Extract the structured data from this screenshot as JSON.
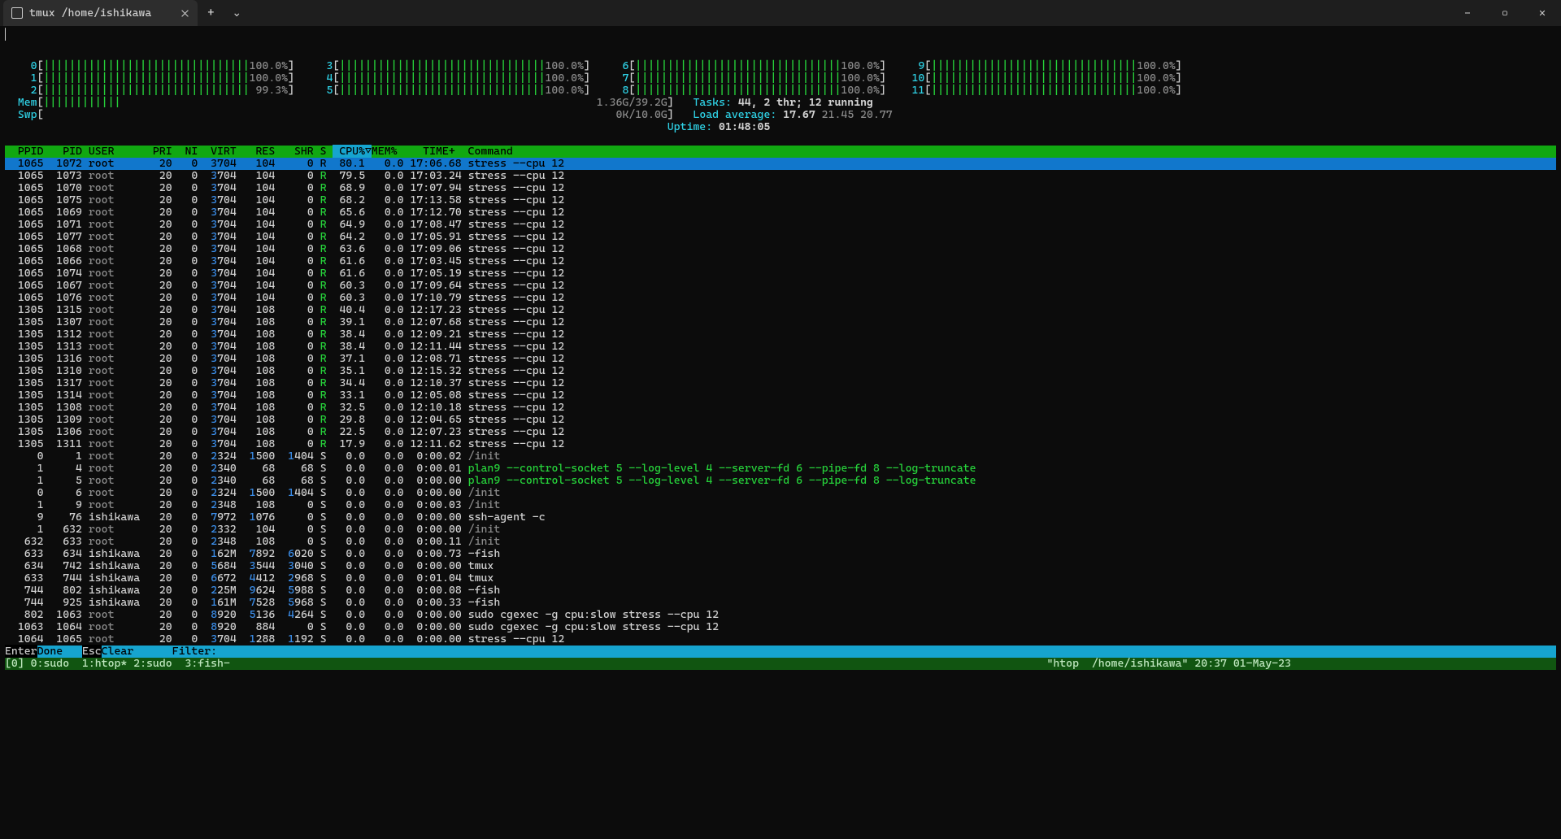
{
  "window": {
    "tab_title": "tmux /home/ishikawa",
    "plus": "+",
    "chev": "⌄",
    "min": "—",
    "max": "▢",
    "close": "✕"
  },
  "cpu_meters": [
    {
      "n": "0",
      "pct": "100.0%"
    },
    {
      "n": "1",
      "pct": "100.0%"
    },
    {
      "n": "2",
      "pct": "99.3%"
    },
    {
      "n": "3",
      "pct": "100.0%"
    },
    {
      "n": "4",
      "pct": "100.0%"
    },
    {
      "n": "5",
      "pct": "100.0%"
    },
    {
      "n": "6",
      "pct": "100.0%"
    },
    {
      "n": "7",
      "pct": "100.0%"
    },
    {
      "n": "8",
      "pct": "100.0%"
    },
    {
      "n": "9",
      "pct": "100.0%"
    },
    {
      "n": "10",
      "pct": "100.0%"
    },
    {
      "n": "11",
      "pct": "100.0%"
    }
  ],
  "mem": {
    "label": "Mem",
    "used": "1.36G",
    "total": "39.2G"
  },
  "swp": {
    "label": "Swp",
    "used": "0K",
    "total": "10.0G"
  },
  "summary": {
    "tasks_label": "Tasks: ",
    "tasks_val": "44, 2 thr; 12 running",
    "load_label": "Load average: ",
    "load_vals": "17.67 21.45 20.77",
    "uptime_label": "Uptime: ",
    "uptime_val": "01:48:05"
  },
  "cols": {
    "ppid": "PPID",
    "pid": "PID",
    "user": "USER",
    "pri": "PRI",
    "ni": "NI",
    "virt": "VIRT",
    "res": "RES",
    "shr": "SHR",
    "s": "S",
    "cpu": "CPU%",
    "sort": "▽",
    "mem": "MEM%",
    "time": "TIME+",
    "cmd": "Command"
  },
  "procs": [
    {
      "ppid": "1065",
      "pid": "1072",
      "user": "root",
      "pri": "20",
      "ni": "0",
      "virt": "3704",
      "res": "104",
      "shr": "0",
      "s": "R",
      "cpu": "80.1",
      "mem": "0.0",
      "time": "17:06.68",
      "cmd": "stress --cpu 12",
      "sel": true
    },
    {
      "ppid": "1065",
      "pid": "1073",
      "user": "root",
      "pri": "20",
      "ni": "0",
      "virt": "3704",
      "res": "104",
      "shr": "0",
      "s": "R",
      "cpu": "79.5",
      "mem": "0.0",
      "time": "17:03.24",
      "cmd": "stress --cpu 12"
    },
    {
      "ppid": "1065",
      "pid": "1070",
      "user": "root",
      "pri": "20",
      "ni": "0",
      "virt": "3704",
      "res": "104",
      "shr": "0",
      "s": "R",
      "cpu": "68.9",
      "mem": "0.0",
      "time": "17:07.94",
      "cmd": "stress --cpu 12"
    },
    {
      "ppid": "1065",
      "pid": "1075",
      "user": "root",
      "pri": "20",
      "ni": "0",
      "virt": "3704",
      "res": "104",
      "shr": "0",
      "s": "R",
      "cpu": "68.2",
      "mem": "0.0",
      "time": "17:13.58",
      "cmd": "stress --cpu 12"
    },
    {
      "ppid": "1065",
      "pid": "1069",
      "user": "root",
      "pri": "20",
      "ni": "0",
      "virt": "3704",
      "res": "104",
      "shr": "0",
      "s": "R",
      "cpu": "65.6",
      "mem": "0.0",
      "time": "17:12.70",
      "cmd": "stress --cpu 12"
    },
    {
      "ppid": "1065",
      "pid": "1071",
      "user": "root",
      "pri": "20",
      "ni": "0",
      "virt": "3704",
      "res": "104",
      "shr": "0",
      "s": "R",
      "cpu": "64.9",
      "mem": "0.0",
      "time": "17:08.47",
      "cmd": "stress --cpu 12"
    },
    {
      "ppid": "1065",
      "pid": "1077",
      "user": "root",
      "pri": "20",
      "ni": "0",
      "virt": "3704",
      "res": "104",
      "shr": "0",
      "s": "R",
      "cpu": "64.2",
      "mem": "0.0",
      "time": "17:05.91",
      "cmd": "stress --cpu 12"
    },
    {
      "ppid": "1065",
      "pid": "1068",
      "user": "root",
      "pri": "20",
      "ni": "0",
      "virt": "3704",
      "res": "104",
      "shr": "0",
      "s": "R",
      "cpu": "63.6",
      "mem": "0.0",
      "time": "17:09.06",
      "cmd": "stress --cpu 12"
    },
    {
      "ppid": "1065",
      "pid": "1066",
      "user": "root",
      "pri": "20",
      "ni": "0",
      "virt": "3704",
      "res": "104",
      "shr": "0",
      "s": "R",
      "cpu": "61.6",
      "mem": "0.0",
      "time": "17:03.45",
      "cmd": "stress --cpu 12"
    },
    {
      "ppid": "1065",
      "pid": "1074",
      "user": "root",
      "pri": "20",
      "ni": "0",
      "virt": "3704",
      "res": "104",
      "shr": "0",
      "s": "R",
      "cpu": "61.6",
      "mem": "0.0",
      "time": "17:05.19",
      "cmd": "stress --cpu 12"
    },
    {
      "ppid": "1065",
      "pid": "1067",
      "user": "root",
      "pri": "20",
      "ni": "0",
      "virt": "3704",
      "res": "104",
      "shr": "0",
      "s": "R",
      "cpu": "60.3",
      "mem": "0.0",
      "time": "17:09.64",
      "cmd": "stress --cpu 12"
    },
    {
      "ppid": "1065",
      "pid": "1076",
      "user": "root",
      "pri": "20",
      "ni": "0",
      "virt": "3704",
      "res": "104",
      "shr": "0",
      "s": "R",
      "cpu": "60.3",
      "mem": "0.0",
      "time": "17:10.79",
      "cmd": "stress --cpu 12"
    },
    {
      "ppid": "1305",
      "pid": "1315",
      "user": "root",
      "pri": "20",
      "ni": "0",
      "virt": "3704",
      "res": "108",
      "shr": "0",
      "s": "R",
      "cpu": "40.4",
      "mem": "0.0",
      "time": "12:17.23",
      "cmd": "stress --cpu 12"
    },
    {
      "ppid": "1305",
      "pid": "1307",
      "user": "root",
      "pri": "20",
      "ni": "0",
      "virt": "3704",
      "res": "108",
      "shr": "0",
      "s": "R",
      "cpu": "39.1",
      "mem": "0.0",
      "time": "12:07.68",
      "cmd": "stress --cpu 12"
    },
    {
      "ppid": "1305",
      "pid": "1312",
      "user": "root",
      "pri": "20",
      "ni": "0",
      "virt": "3704",
      "res": "108",
      "shr": "0",
      "s": "R",
      "cpu": "38.4",
      "mem": "0.0",
      "time": "12:09.21",
      "cmd": "stress --cpu 12"
    },
    {
      "ppid": "1305",
      "pid": "1313",
      "user": "root",
      "pri": "20",
      "ni": "0",
      "virt": "3704",
      "res": "108",
      "shr": "0",
      "s": "R",
      "cpu": "38.4",
      "mem": "0.0",
      "time": "12:11.44",
      "cmd": "stress --cpu 12"
    },
    {
      "ppid": "1305",
      "pid": "1316",
      "user": "root",
      "pri": "20",
      "ni": "0",
      "virt": "3704",
      "res": "108",
      "shr": "0",
      "s": "R",
      "cpu": "37.1",
      "mem": "0.0",
      "time": "12:08.71",
      "cmd": "stress --cpu 12"
    },
    {
      "ppid": "1305",
      "pid": "1310",
      "user": "root",
      "pri": "20",
      "ni": "0",
      "virt": "3704",
      "res": "108",
      "shr": "0",
      "s": "R",
      "cpu": "35.1",
      "mem": "0.0",
      "time": "12:15.32",
      "cmd": "stress --cpu 12"
    },
    {
      "ppid": "1305",
      "pid": "1317",
      "user": "root",
      "pri": "20",
      "ni": "0",
      "virt": "3704",
      "res": "108",
      "shr": "0",
      "s": "R",
      "cpu": "34.4",
      "mem": "0.0",
      "time": "12:10.37",
      "cmd": "stress --cpu 12"
    },
    {
      "ppid": "1305",
      "pid": "1314",
      "user": "root",
      "pri": "20",
      "ni": "0",
      "virt": "3704",
      "res": "108",
      "shr": "0",
      "s": "R",
      "cpu": "33.1",
      "mem": "0.0",
      "time": "12:05.08",
      "cmd": "stress --cpu 12"
    },
    {
      "ppid": "1305",
      "pid": "1308",
      "user": "root",
      "pri": "20",
      "ni": "0",
      "virt": "3704",
      "res": "108",
      "shr": "0",
      "s": "R",
      "cpu": "32.5",
      "mem": "0.0",
      "time": "12:10.18",
      "cmd": "stress --cpu 12"
    },
    {
      "ppid": "1305",
      "pid": "1309",
      "user": "root",
      "pri": "20",
      "ni": "0",
      "virt": "3704",
      "res": "108",
      "shr": "0",
      "s": "R",
      "cpu": "29.8",
      "mem": "0.0",
      "time": "12:04.65",
      "cmd": "stress --cpu 12"
    },
    {
      "ppid": "1305",
      "pid": "1306",
      "user": "root",
      "pri": "20",
      "ni": "0",
      "virt": "3704",
      "res": "108",
      "shr": "0",
      "s": "R",
      "cpu": "22.5",
      "mem": "0.0",
      "time": "12:07.23",
      "cmd": "stress --cpu 12"
    },
    {
      "ppid": "1305",
      "pid": "1311",
      "user": "root",
      "pri": "20",
      "ni": "0",
      "virt": "3704",
      "res": "108",
      "shr": "0",
      "s": "R",
      "cpu": "17.9",
      "mem": "0.0",
      "time": "12:11.62",
      "cmd": "stress --cpu 12"
    },
    {
      "ppid": "0",
      "pid": "1",
      "user": "root",
      "pri": "20",
      "ni": "0",
      "virt": "2324",
      "res": "1500",
      "shr": "1404",
      "s": "S",
      "cpu": "0.0",
      "mem": "0.0",
      "time": "0:00.02",
      "cmd": "/init",
      "cmdcol": "dim"
    },
    {
      "ppid": "1",
      "pid": "4",
      "user": "root",
      "pri": "20",
      "ni": "0",
      "virt": "2340",
      "res": "68",
      "shr": "68",
      "s": "S",
      "cpu": "0.0",
      "mem": "0.0",
      "time": "0:00.01",
      "cmd": "plan9 --control-socket 5 --log-level 4 --server-fd 6 --pipe-fd 8 --log-truncate",
      "cmdcol": "green"
    },
    {
      "ppid": "1",
      "pid": "5",
      "user": "root",
      "pri": "20",
      "ni": "0",
      "virt": "2340",
      "res": "68",
      "shr": "68",
      "s": "S",
      "cpu": "0.0",
      "mem": "0.0",
      "time": "0:00.00",
      "cmd": "plan9 --control-socket 5 --log-level 4 --server-fd 6 --pipe-fd 8 --log-truncate",
      "cmdcol": "green"
    },
    {
      "ppid": "0",
      "pid": "6",
      "user": "root",
      "pri": "20",
      "ni": "0",
      "virt": "2324",
      "res": "1500",
      "shr": "1404",
      "s": "S",
      "cpu": "0.0",
      "mem": "0.0",
      "time": "0:00.00",
      "cmd": "/init",
      "cmdcol": "dim"
    },
    {
      "ppid": "1",
      "pid": "9",
      "user": "root",
      "pri": "20",
      "ni": "0",
      "virt": "2348",
      "res": "108",
      "shr": "0",
      "s": "S",
      "cpu": "0.0",
      "mem": "0.0",
      "time": "0:00.03",
      "cmd": "/init",
      "cmdcol": "dim"
    },
    {
      "ppid": "9",
      "pid": "76",
      "user": "ishikawa",
      "pri": "20",
      "ni": "0",
      "virt": "7972",
      "res": "1076",
      "shr": "0",
      "s": "S",
      "cpu": "0.0",
      "mem": "0.0",
      "time": "0:00.00",
      "cmd": "ssh-agent -c"
    },
    {
      "ppid": "1",
      "pid": "632",
      "user": "root",
      "pri": "20",
      "ni": "0",
      "virt": "2332",
      "res": "104",
      "shr": "0",
      "s": "S",
      "cpu": "0.0",
      "mem": "0.0",
      "time": "0:00.00",
      "cmd": "/init",
      "cmdcol": "dim"
    },
    {
      "ppid": "632",
      "pid": "633",
      "user": "root",
      "pri": "20",
      "ni": "0",
      "virt": "2348",
      "res": "108",
      "shr": "0",
      "s": "S",
      "cpu": "0.0",
      "mem": "0.0",
      "time": "0:00.11",
      "cmd": "/init",
      "cmdcol": "dim"
    },
    {
      "ppid": "633",
      "pid": "634",
      "user": "ishikawa",
      "pri": "20",
      "ni": "0",
      "virt": "162M",
      "res": "7892",
      "shr": "6020",
      "s": "S",
      "cpu": "0.0",
      "mem": "0.0",
      "time": "0:00.73",
      "cmd": "-fish"
    },
    {
      "ppid": "634",
      "pid": "742",
      "user": "ishikawa",
      "pri": "20",
      "ni": "0",
      "virt": "5684",
      "res": "3544",
      "shr": "3040",
      "s": "S",
      "cpu": "0.0",
      "mem": "0.0",
      "time": "0:00.00",
      "cmd": "tmux"
    },
    {
      "ppid": "633",
      "pid": "744",
      "user": "ishikawa",
      "pri": "20",
      "ni": "0",
      "virt": "6672",
      "res": "4412",
      "shr": "2968",
      "s": "S",
      "cpu": "0.0",
      "mem": "0.0",
      "time": "0:01.04",
      "cmd": "tmux"
    },
    {
      "ppid": "744",
      "pid": "802",
      "user": "ishikawa",
      "pri": "20",
      "ni": "0",
      "virt": "225M",
      "res": "9624",
      "shr": "5988",
      "s": "S",
      "cpu": "0.0",
      "mem": "0.0",
      "time": "0:00.08",
      "cmd": "-fish"
    },
    {
      "ppid": "744",
      "pid": "925",
      "user": "ishikawa",
      "pri": "20",
      "ni": "0",
      "virt": "161M",
      "res": "7528",
      "shr": "5968",
      "s": "S",
      "cpu": "0.0",
      "mem": "0.0",
      "time": "0:00.33",
      "cmd": "-fish"
    },
    {
      "ppid": "802",
      "pid": "1063",
      "user": "root",
      "pri": "20",
      "ni": "0",
      "virt": "8920",
      "res": "5136",
      "shr": "4264",
      "s": "S",
      "cpu": "0.0",
      "mem": "0.0",
      "time": "0:00.00",
      "cmd": "sudo cgexec -g cpu:slow stress --cpu 12"
    },
    {
      "ppid": "1063",
      "pid": "1064",
      "user": "root",
      "pri": "20",
      "ni": "0",
      "virt": "8920",
      "res": "884",
      "shr": "0",
      "s": "S",
      "cpu": "0.0",
      "mem": "0.0",
      "time": "0:00.00",
      "cmd": "sudo cgexec -g cpu:slow stress --cpu 12"
    },
    {
      "ppid": "1064",
      "pid": "1065",
      "user": "root",
      "pri": "20",
      "ni": "0",
      "virt": "3704",
      "res": "1288",
      "shr": "1192",
      "s": "S",
      "cpu": "0.0",
      "mem": "0.0",
      "time": "0:00.00",
      "cmd": "stress --cpu 12"
    }
  ],
  "footer": {
    "k1": "Enter",
    "a1": "Done   ",
    "k2": "Esc",
    "a2": "Clear   ",
    "filter_label": "Filter: "
  },
  "tmux": {
    "left": "[0] 0:sudo  1:htop* 2:sudo  3:fish-",
    "right": "\"htop  /home/ishikawa\" 20:37 01-May-23"
  }
}
